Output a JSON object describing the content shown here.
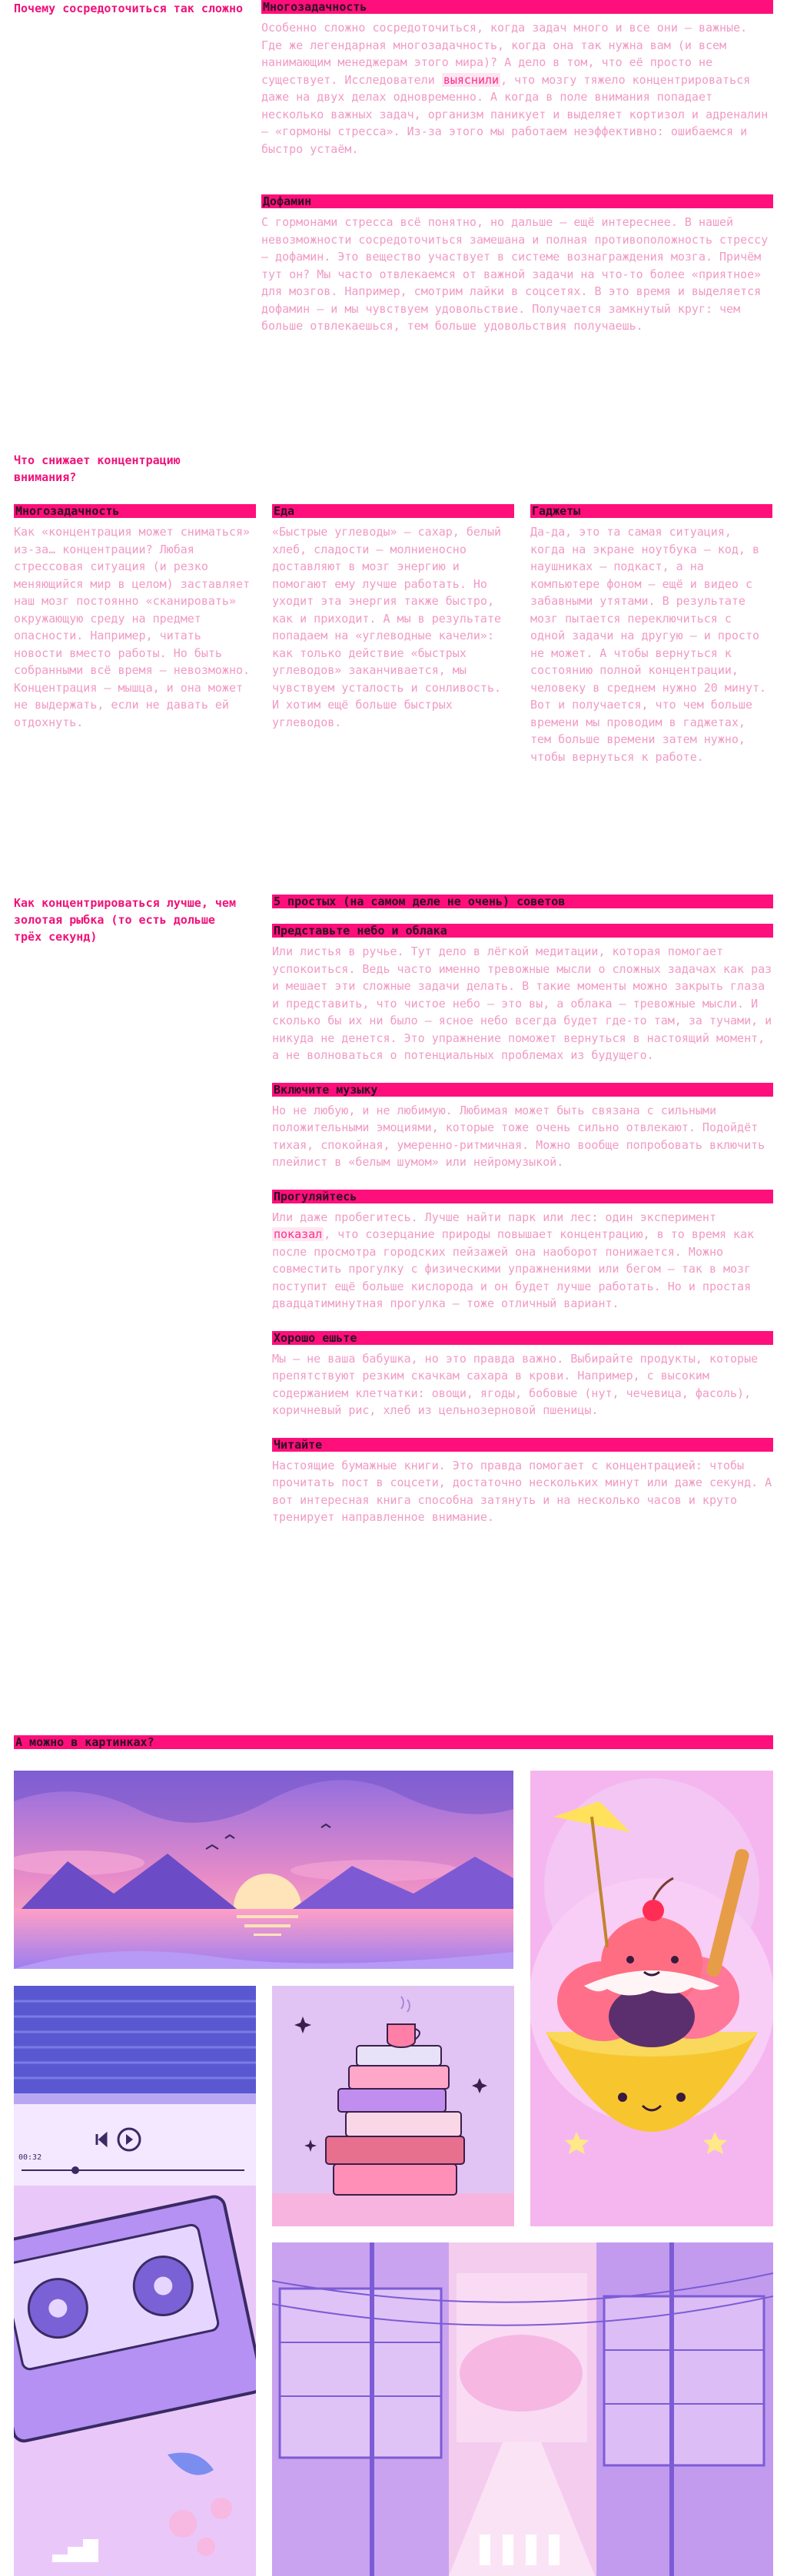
{
  "section1": {
    "title": "Почему сосредоточиться так сложно",
    "multitask": {
      "heading": "Многозадачность",
      "text_a": "Особенно сложно сосредоточиться, когда задач много и все они — важные. Где же легендарная многозадачность, когда она так нужна вам (и всем нанимающим менеджерам этого мира)? А дело в том, что её просто не существует. Исследователи",
      "highlight": "выяснили",
      "text_b": ", что мозгу тяжело концентрироваться даже на двух делах одновременно. А когда в поле внимания попадает несколько важных задач, организм паникует и выделяет кортизол и адреналин — «гормоны стресса». Из-за этого мы работаем неэффективно: ошибаемся и быстро устаём."
    },
    "dopamine": {
      "heading": "Дофамин",
      "text": "С гормонами стресса всё понятно, но дальше — ещё интереснее. В нашей невозможности сосредоточиться замешана и полная противоположность стрессу — дофамин. Это вещество участвует в системе вознаграждения мозга. Причём тут он? Мы часто отвлекаемся от важной задачи на что-то более «приятное» для мозгов. Например, смотрим лайки в соцсетях. В это время и выделяется дофамин — и мы чувствуем удовольствие. Получается замкнутый круг: чем больше отвлекаешься, тем больше удовольствия получаешь."
    }
  },
  "section2": {
    "title": "Что снижает концентрацию внимания?",
    "columns": [
      {
        "heading": "Многозадачность",
        "text": "Как «концентрация может сниматься» из-за… концентрации? Любая стрессовая ситуация (и резко меняющийся мир в целом) заставляет наш мозг постоянно «сканировать» окружающую среду на предмет опасности. Например, читать новости вместо работы. Но быть собранными всё время — невозможно. Концентрация — мышца, и она может не выдержать, если не давать ей отдохнуть."
      },
      {
        "heading": "Еда",
        "text": "«Быстрые углеводы» — сахар, белый хлеб, сладости — молниеносно доставляют в мозг энергию и помогают ему лучше работать. Но уходит эта энергия также быстро, как и приходит. А мы в результате попадаем на «углеводные качели»: как только действие «быстрых углеводов» заканчивается, мы чувствуем усталость и сонливость. И хотим ещё больше быстрых углеводов."
      },
      {
        "heading": "Гаджеты",
        "text": "Да-да, это та самая ситуация, когда на экране ноутбука — код, в наушниках — подкаст, а на компьютере фоном — ещё и видео с забавными утятами. В результате мозг пытается переключиться с одной задачи на другую — и просто не может. А чтобы вернуться к состоянию полной концентрации, человеку в среднем нужно 20 минут. Вот и получается, что чем больше времени мы проводим в гаджетах, тем больше времени затем нужно, чтобы вернуться к работе."
      }
    ]
  },
  "section3": {
    "title": "Как концентрироваться лучше, чем золотая рыбка (то есть дольше трёх секунд)",
    "bar": "5 простых (на самом деле не очень) советов",
    "tips": [
      {
        "heading": "Представьте небо и облака",
        "text": "Или листья в ручье. Тут дело в лёгкой медитации, которая помогает успокоиться. Ведь часто именно тревожные мысли о сложных задачах как раз и мешает эти сложные задачи делать. В такие моменты можно закрыть глаза и представить, что чистое небо — это вы, а облака — тревожные мысли. И сколько бы их ни было — ясное небо всегда будет где-то там, за тучами, и никуда не денется. Это упражнение поможет вернуться в настоящий момент, а не волноваться о потенциальных проблемах из будущего."
      },
      {
        "heading": "Включите музыку",
        "text": "Но не любую, и не любимую. Любимая может быть связана с сильными положительными эмоциями, которые тоже очень сильно отвлекают. Подойдёт тихая, спокойная, умеренно-ритмичная. Можно вообще попробовать включить плейлист в «белым шумом» или нейромузыкой."
      },
      {
        "heading": "Прогуляйтесь",
        "text_a": "Или даже пробегитесь. Лучше найти парк или лес: один эксперимент ",
        "highlight": "показал",
        "text_b": ", что созерцание природы повышает концентрацию, в то время как после просмотра городских пейзажей она наоборот понижается. Можно совместить прогулку с физическими упражнениями или бегом — так в мозг поступит ещё больше кислорода и он будет лучше работать. Но и простая двадцатиминутная прогулка — тоже отличный вариант."
      },
      {
        "heading": "Хорошо ешьте",
        "text": "Мы — не ваша бабушка, но это правда важно. Выбирайте продукты, которые препятствуют резким скачкам сахара в крови. Например, с высоким содержанием клетчатки: овощи, ягоды, бобовые (нут, чечевица, фасоль), коричневый рис, хлеб из цельнозерновой пшеницы."
      },
      {
        "heading": "Читайте",
        "text": "Настоящие бумажные книги. Это правда помогает с концентрацией: чтобы прочитать пост в соцсети, достаточно нескольких минут или даже секунд. А вот интересная книга способна затянуть и на несколько часов и круто тренирует направленное внимание."
      }
    ]
  },
  "gallery": {
    "bar": "А можно в картинках?",
    "cassette_time": "00:32",
    "colors": {
      "accent": "#ff0f7b",
      "pale_pink": "#f19ac4",
      "lavender": "#c9a3ef",
      "purple": "#7b5cd6"
    }
  }
}
